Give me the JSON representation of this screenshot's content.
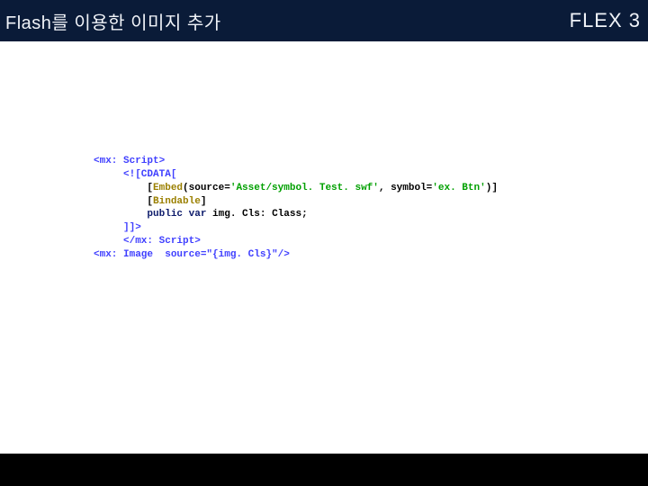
{
  "header": {
    "title_left": "Flash를 이용한 이미지 추가",
    "title_right": "FLEX 3"
  },
  "code": {
    "l1_a": "<mx: Script>",
    "l2_a": "     <![CDATA[",
    "l3_a": "         [",
    "l3_b": "Embed",
    "l3_c": "(source=",
    "l3_d": "'Asset/symbol. Test. swf'",
    "l3_e": ", symbol=",
    "l3_f": "'ex. Btn'",
    "l3_g": ")]",
    "l4_a": "         [",
    "l4_b": "Bindable",
    "l4_c": "]",
    "l5_a": "         ",
    "l5_b": "public",
    "l5_c": " ",
    "l5_d": "var",
    "l5_e": " img. Cls: Class;",
    "l6_a": "     ]]>",
    "l7_a": "     </mx: Script>",
    "l8_a": "<mx: Image  source=\"{img. Cls}\"/>"
  }
}
